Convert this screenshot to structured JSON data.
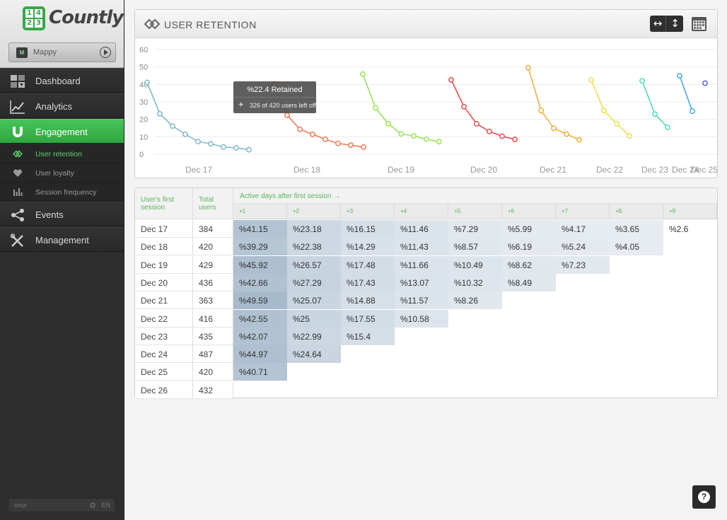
{
  "logo": {
    "text": "Countly",
    "icon_cells": [
      "1",
      "4",
      "2",
      "3"
    ]
  },
  "app_selector": {
    "name": "Mappy",
    "icon_text": "M"
  },
  "nav": [
    {
      "id": "dashboard",
      "label": "Dashboard",
      "icon": "dashboard-icon"
    },
    {
      "id": "analytics",
      "label": "Analytics",
      "icon": "analytics-icon"
    },
    {
      "id": "engagement",
      "label": "Engagement",
      "icon": "magnet-icon",
      "active": true
    },
    {
      "id": "events",
      "label": "Events",
      "icon": "share-icon"
    },
    {
      "id": "management",
      "label": "Management",
      "icon": "tools-icon"
    }
  ],
  "subnav": [
    {
      "label": "User retention",
      "icon": "retention-icon",
      "active": true
    },
    {
      "label": "User loyalty",
      "icon": "heart-icon"
    },
    {
      "label": "Session frequency",
      "icon": "bars-icon"
    }
  ],
  "user": {
    "name": "onur",
    "lang": "EN"
  },
  "chart_panel": {
    "title": "USER RETENTION"
  },
  "tooltip": {
    "title": "%22.4 Retained",
    "subtitle": "326 of 420 users left off"
  },
  "chart_data": {
    "type": "line",
    "title": "USER RETENTION",
    "ylim": [
      0,
      60
    ],
    "yticks": [
      0,
      10,
      20,
      30,
      40,
      50,
      60
    ],
    "grid": true,
    "categories": [
      "Dec 17",
      "Dec 18",
      "Dec 19",
      "Dec 20",
      "Dec 21",
      "Dec 22",
      "Dec 23",
      "Dec 24",
      "Dec 25"
    ],
    "series": [
      {
        "color": "#7fb9c8",
        "values": [
          41.15,
          23.18,
          16.15,
          11.46,
          7.29,
          5.99,
          4.17,
          3.65,
          2.6
        ]
      },
      {
        "color": "#ee7a57",
        "values": [
          39.29,
          22.38,
          14.29,
          11.43,
          8.57,
          6.19,
          5.24,
          4.05
        ]
      },
      {
        "color": "#9be35a",
        "values": [
          45.92,
          26.57,
          17.48,
          11.66,
          10.49,
          8.62,
          7.23
        ]
      },
      {
        "color": "#e35050",
        "values": [
          42.66,
          27.29,
          17.43,
          13.07,
          10.32,
          8.49
        ]
      },
      {
        "color": "#f0b040",
        "values": [
          49.59,
          25.07,
          14.88,
          11.57,
          8.26
        ]
      },
      {
        "color": "#ece050",
        "values": [
          42.55,
          25,
          17.55,
          10.58
        ]
      },
      {
        "color": "#50d8b8",
        "values": [
          42.07,
          22.99,
          15.4
        ]
      },
      {
        "color": "#4aa8e0",
        "values": [
          44.97,
          24.64
        ]
      },
      {
        "color": "#5a5ed0",
        "values": [
          40.71
        ]
      }
    ],
    "highlight": {
      "series": 1,
      "index": 0
    }
  },
  "table": {
    "col_first_session": "User's first session",
    "col_total_users": "Total users",
    "active_days_header": "Active days after first session →",
    "day_headers": [
      "+1",
      "+2",
      "+3",
      "+4",
      "+5",
      "+6",
      "+7",
      "+8",
      "+9"
    ],
    "rows": [
      {
        "date": "Dec 17",
        "total": "384",
        "values": [
          "%41.15",
          "%23.18",
          "%16.15",
          "%11.46",
          "%7.29",
          "%5.99",
          "%4.17",
          "%3.65",
          "%2.6"
        ]
      },
      {
        "date": "Dec 18",
        "total": "420",
        "values": [
          "%39.29",
          "%22.38",
          "%14.29",
          "%11.43",
          "%8.57",
          "%6.19",
          "%5.24",
          "%4.05"
        ]
      },
      {
        "date": "Dec 19",
        "total": "429",
        "values": [
          "%45.92",
          "%26.57",
          "%17.48",
          "%11.66",
          "%10.49",
          "%8.62",
          "%7.23"
        ]
      },
      {
        "date": "Dec 20",
        "total": "436",
        "values": [
          "%42.66",
          "%27.29",
          "%17.43",
          "%13.07",
          "%10.32",
          "%8.49"
        ]
      },
      {
        "date": "Dec 21",
        "total": "363",
        "values": [
          "%49.59",
          "%25.07",
          "%14.88",
          "%11.57",
          "%8.26"
        ]
      },
      {
        "date": "Dec 22",
        "total": "416",
        "values": [
          "%42.55",
          "%25",
          "%17.55",
          "%10.58"
        ]
      },
      {
        "date": "Dec 23",
        "total": "435",
        "values": [
          "%42.07",
          "%22.99",
          "%15.4"
        ]
      },
      {
        "date": "Dec 24",
        "total": "487",
        "values": [
          "%44.97",
          "%24.64"
        ]
      },
      {
        "date": "Dec 25",
        "total": "420",
        "values": [
          "%40.71"
        ]
      },
      {
        "date": "Dec 26",
        "total": "432",
        "values": []
      }
    ]
  }
}
